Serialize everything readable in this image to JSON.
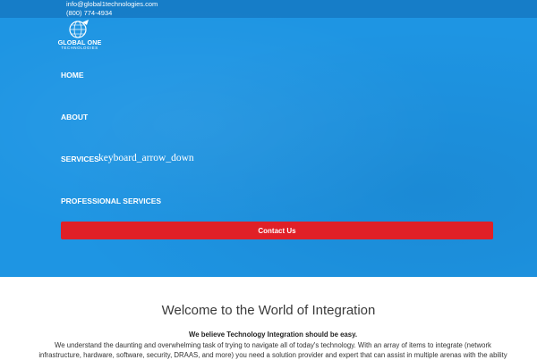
{
  "topbar": {
    "email": "info@global1technologies.com",
    "phone": "(800) 774-4934"
  },
  "logo": {
    "name": "GLOBAL ONE",
    "subtitle": "TECHNOLOGIES"
  },
  "nav": {
    "items": [
      {
        "label": "HOME"
      },
      {
        "label": "ABOUT"
      },
      {
        "label": "SERVICES",
        "icon_text": "keyboard_arrow_down"
      },
      {
        "label": "PROFESSIONAL SERVICES"
      }
    ],
    "contact_button": "Contact Us"
  },
  "main": {
    "heading": "Welcome to the World of Integration",
    "tagline": "We believe Technology Integration should be easy.",
    "paragraph_line1": "We understand the daunting and overwhelming task of trying to navigate all of today's technology.  With an array of items to integrate (network",
    "paragraph_line2": "infrastructure, hardware, software, security, DRAAS, and more) you need a solution provider and expert that can assist in multiple arenas with the ability"
  },
  "colors": {
    "hero_blue": "#1e95e3",
    "button_red": "#e02027",
    "text_dark": "#3a3a3a"
  }
}
